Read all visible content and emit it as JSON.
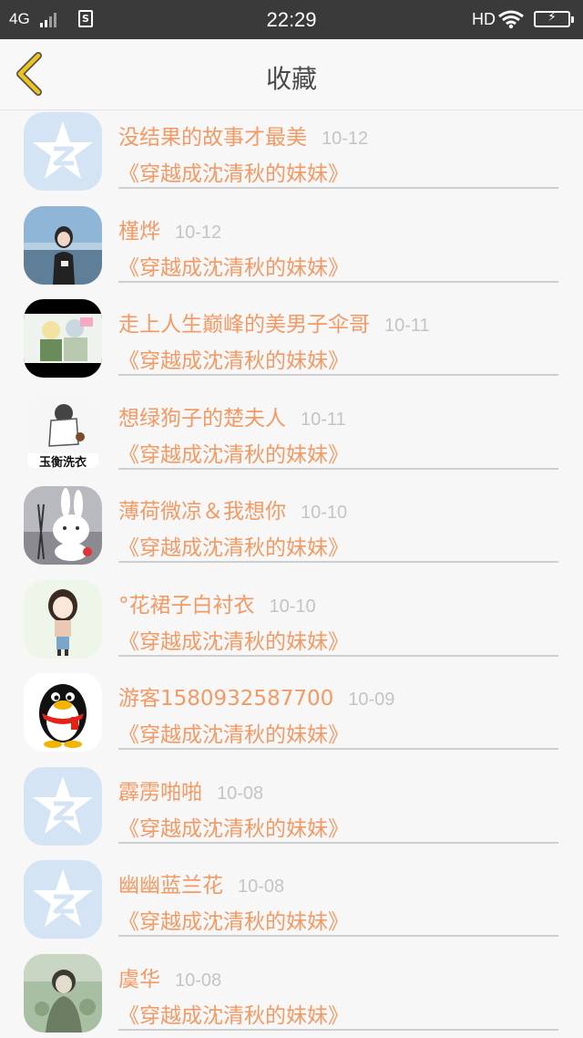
{
  "status_bar": {
    "network": "4G",
    "time": "22:29",
    "hd": "HD"
  },
  "header": {
    "title": "收藏",
    "back_icon": "chevron-left-icon",
    "accent_color": "#f0c419"
  },
  "favorites": [
    {
      "name": "没结果的故事才最美",
      "date": "10-12",
      "book": "《穿越成沈清秋的妹妹》",
      "avatar": "qzone-star"
    },
    {
      "name": "槿烨",
      "date": "10-12",
      "book": "《穿越成沈清秋的妹妹》",
      "avatar": "girl-photo"
    },
    {
      "name": "走上人生巅峰的美男子伞哥",
      "date": "10-11",
      "book": "《穿越成沈清秋的妹妹》",
      "avatar": "couple-photo"
    },
    {
      "name": "想绿狗子的楚夫人",
      "date": "10-11",
      "book": "《穿越成沈清秋的妹妹》",
      "avatar": "sketch-figure"
    },
    {
      "name": "薄荷微凉＆我想你",
      "date": "10-10",
      "book": "《穿越成沈清秋的妹妹》",
      "avatar": "bunny"
    },
    {
      "name": "°花裙子白衬衣",
      "date": "10-10",
      "book": "《穿越成沈清秋的妹妹》",
      "avatar": "cartoon-girl"
    },
    {
      "name": "游客1580932587700",
      "date": "10-09",
      "book": "《穿越成沈清秋的妹妹》",
      "avatar": "penguin"
    },
    {
      "name": "霹雳啪啪",
      "date": "10-08",
      "book": "《穿越成沈清秋的妹妹》",
      "avatar": "qzone-star"
    },
    {
      "name": "幽幽蓝兰花",
      "date": "10-08",
      "book": "《穿越成沈清秋的妹妹》",
      "avatar": "qzone-star"
    },
    {
      "name": "虞华",
      "date": "10-08",
      "book": "《穿越成沈清秋的妹妹》",
      "avatar": "green-figure"
    }
  ],
  "colors": {
    "status_bar_bg": "#3a3a3a",
    "name_color": "#f39a64",
    "date_color": "#c4c4c4"
  }
}
